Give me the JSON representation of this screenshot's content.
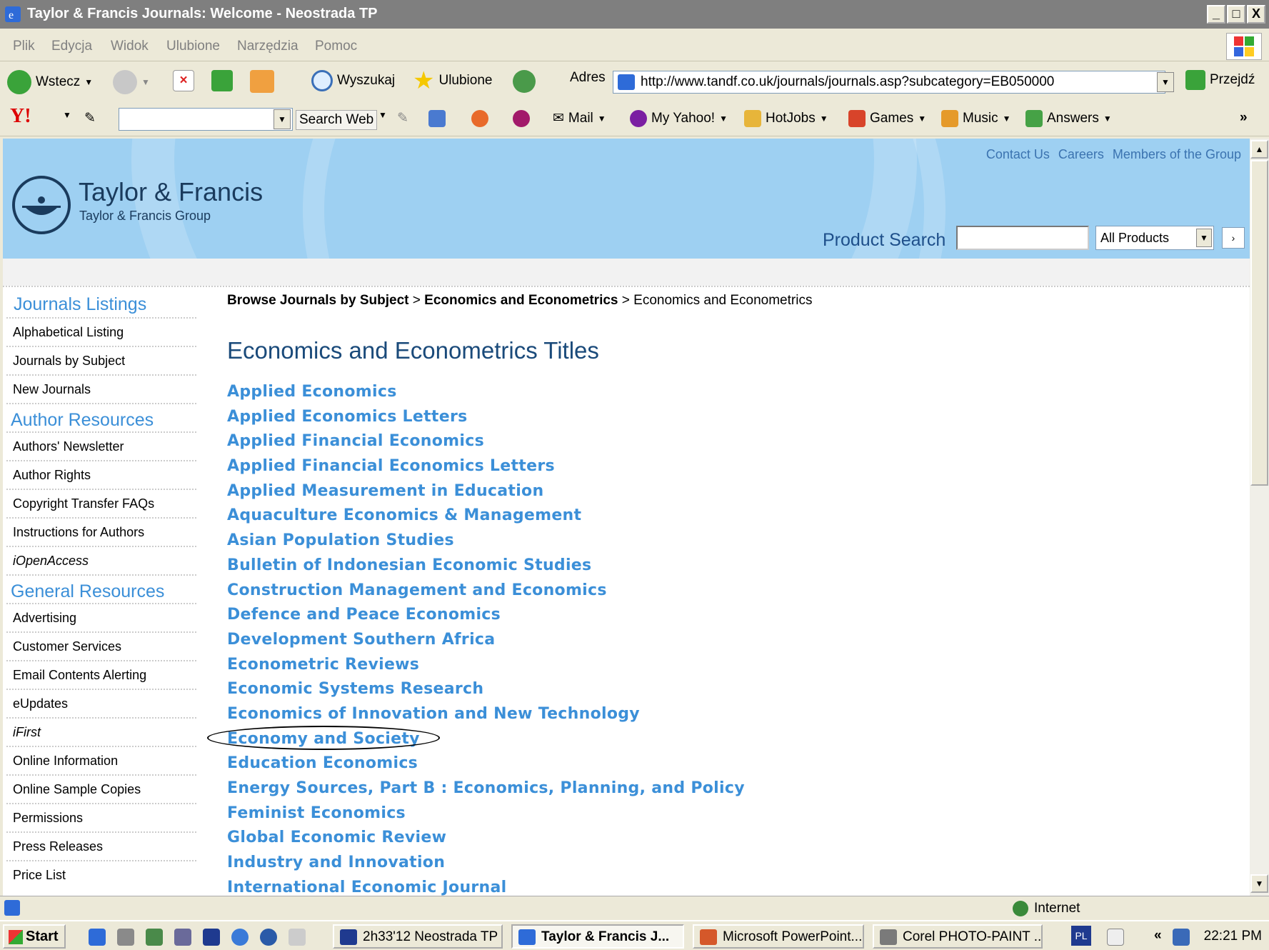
{
  "window": {
    "title": "Taylor & Francis Journals: Welcome - Neostrada TP",
    "buttons": [
      "_",
      "□",
      "X"
    ]
  },
  "menu": [
    "Plik",
    "Edycja",
    "Widok",
    "Ulubione",
    "Narzędzia",
    "Pomoc"
  ],
  "toolbar": {
    "back": "Wstecz",
    "search": "Wyszukaj",
    "favorites": "Ulubione",
    "address_label": "Adres",
    "address_value": "http://www.tandf.co.uk/journals/journals.asp?subcategory=EB050000",
    "go": "Przejdź"
  },
  "yahoo": {
    "logo": "Y!",
    "search_web": "Search Web",
    "links": [
      "Mail",
      "My Yahoo!",
      "HotJobs",
      "Games",
      "Music",
      "Answers"
    ],
    "more": "»"
  },
  "site": {
    "top_links": [
      "Contact Us",
      "Careers",
      "Members of the Group"
    ],
    "logo_name": "Taylor & Francis",
    "logo_sub": "Taylor & Francis Group",
    "product_search_label": "Product Search",
    "product_search_select": "All Products",
    "product_search_go": "›"
  },
  "sidebar": {
    "journals_heading": "Journals Listings",
    "journals": [
      "Alphabetical Listing",
      "Journals by Subject",
      "New Journals"
    ],
    "author_heading": "Author Resources",
    "author": [
      "Authors' Newsletter",
      "Author Rights",
      "Copyright Transfer FAQs",
      "Instructions for Authors",
      "iOpenAccess"
    ],
    "general_heading": "General Resources",
    "general": [
      "Advertising",
      "Customer Services",
      "Email Contents Alerting",
      "eUpdates",
      "iFirst",
      "Online Information",
      "Online Sample Copies",
      "Permissions",
      "Press Releases",
      "Price List"
    ]
  },
  "main": {
    "breadcrumb": [
      "Browse Journals by Subject",
      "Economics and Econometrics",
      "Economics and Econometrics"
    ],
    "breadcrumb_sep": ">",
    "title": "Economics and Econometrics Titles",
    "journals": [
      "Applied Economics",
      "Applied Economics Letters",
      "Applied Financial Economics",
      "Applied Financial Economics Letters",
      "Applied Measurement in Education",
      "Aquaculture Economics & Management",
      "Asian Population Studies",
      "Bulletin of Indonesian Economic Studies",
      "Construction Management and Economics",
      "Defence and Peace Economics",
      "Development Southern Africa",
      "Econometric Reviews",
      "Economic Systems Research",
      "Economics of Innovation and New Technology",
      "Economy and Society",
      "Education Economics",
      "Energy Sources, Part B : Economics, Planning, and Policy",
      "Feminist Economics",
      "Global Economic Review",
      "Industry and Innovation",
      "International Economic Journal"
    ]
  },
  "status": {
    "zone": "Internet"
  },
  "taskbar": {
    "start": "Start",
    "buttons": [
      "2h33'12 Neostrada TP",
      "Taylor & Francis J...",
      "Microsoft PowerPoint...",
      "Corel PHOTO-PAINT ..."
    ],
    "lang": "PL",
    "tray_arrow": "«",
    "clock": "22:21 PM"
  },
  "colors": {
    "banner": "#9ed0f2",
    "link": "#3b8fd8",
    "title": "#1a4a7a"
  }
}
